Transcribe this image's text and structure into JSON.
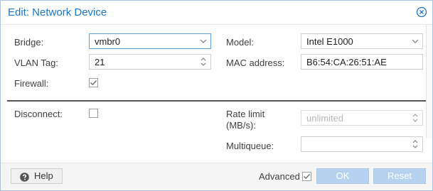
{
  "dialog": {
    "title": "Edit: Network Device",
    "close_icon": "close-circle-icon"
  },
  "form": {
    "bridge": {
      "label": "Bridge:",
      "value": "vmbr0"
    },
    "vlan_tag": {
      "label": "VLAN Tag:",
      "value": "21"
    },
    "firewall": {
      "label": "Firewall:",
      "checked": true
    },
    "model": {
      "label": "Model:",
      "value": "Intel E1000"
    },
    "mac_address": {
      "label": "MAC address:",
      "value": "B6:54:CA:26:51:AE"
    },
    "disconnect": {
      "label": "Disconnect:",
      "checked": false
    },
    "rate_limit": {
      "label_line1": "Rate limit",
      "label_line2": "(MB/s):",
      "placeholder": "unlimited"
    },
    "multiqueue": {
      "label": "Multiqueue:",
      "value": ""
    }
  },
  "footer": {
    "help_label": "Help",
    "advanced_label": "Advanced",
    "advanced_checked": true,
    "ok_label": "OK",
    "reset_label": "Reset"
  },
  "colors": {
    "title": "#1b74c5",
    "primary_button": "#b7d2ee",
    "focus_border": "#5fa2dd"
  }
}
